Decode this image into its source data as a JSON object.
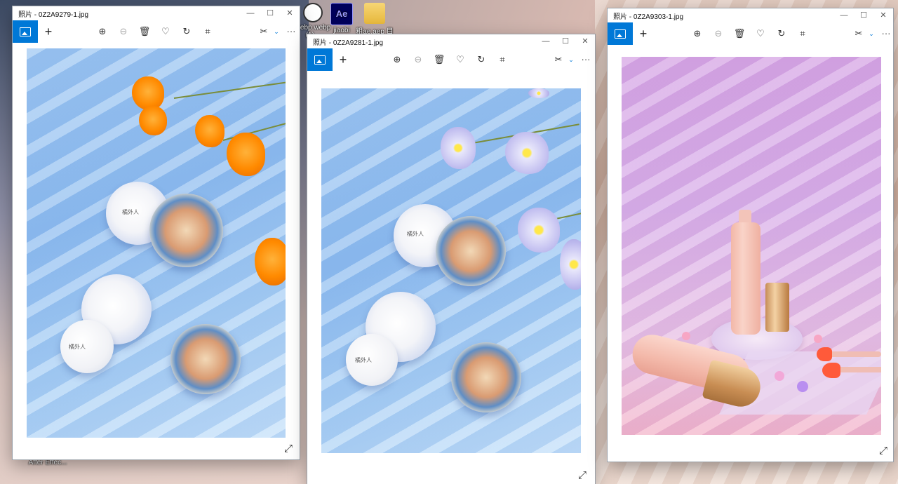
{
  "desktop": {
    "icons": [
      {
        "label": "webp.webp (1)...",
        "icon": "clock-icon"
      },
      {
        "label": "jiaobi",
        "icon": "ae-icon"
      },
      {
        "label": "粗ae.aep 目录",
        "icon": "folder-icon"
      },
      {
        "label": "After Effec...",
        "icon": "ae-icon"
      }
    ],
    "ae_badge": "Ae"
  },
  "windows": [
    {
      "title": "照片 - 0Z2A9279-1.jpg",
      "controls": {
        "minimize": "—",
        "maximize": "☐",
        "close": "✕"
      },
      "toolbar": {
        "add": "+",
        "more": "···"
      },
      "photo": {
        "label_front": "橘外人",
        "label_back": "橘外人"
      }
    },
    {
      "title": "照片 - 0Z2A9281-1.jpg",
      "controls": {
        "minimize": "—",
        "maximize": "☐",
        "close": "✕"
      },
      "toolbar": {
        "add": "+",
        "more": "···"
      },
      "photo": {
        "label_front": "橘外人",
        "label_back": "橘外人"
      }
    },
    {
      "title": "照片 - 0Z2A9303-1.jpg",
      "controls": {
        "minimize": "—",
        "maximize": "☐",
        "close": "✕"
      },
      "toolbar": {
        "add": "+",
        "more": "···"
      }
    }
  ],
  "colors": {
    "accent": "#0078d7",
    "blue_photo": "#9ec7f2",
    "pink_photo": "#dab2ea"
  }
}
